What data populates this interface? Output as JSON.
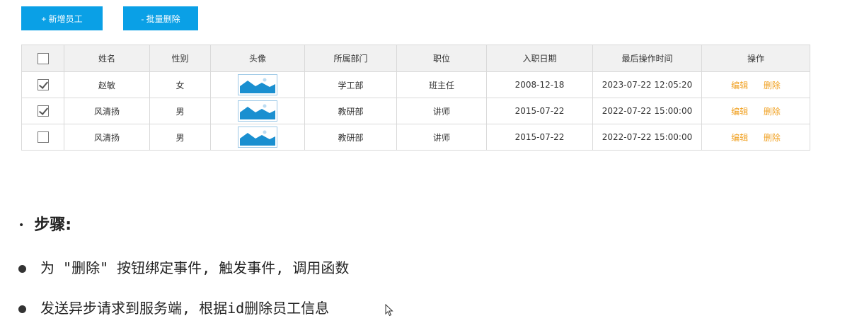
{
  "toolbar": {
    "add_label": "+ 新增员工",
    "batch_delete_label": "- 批量删除"
  },
  "table": {
    "headers": [
      "姓名",
      "性别",
      "头像",
      "所属部门",
      "职位",
      "入职日期",
      "最后操作时间",
      "操作"
    ],
    "rows": [
      {
        "checked": true,
        "name": "赵敏",
        "gender": "女",
        "dept": "学工部",
        "position": "班主任",
        "entry_date": "2008-12-18",
        "last_op": "2023-07-22 12:05:20",
        "edit": "编辑",
        "delete": "删除"
      },
      {
        "checked": true,
        "name": "风清扬",
        "gender": "男",
        "dept": "教研部",
        "position": "讲师",
        "entry_date": "2015-07-22",
        "last_op": "2022-07-22 15:00:00",
        "edit": "编辑",
        "delete": "删除"
      },
      {
        "checked": false,
        "name": "风清扬",
        "gender": "男",
        "dept": "教研部",
        "position": "讲师",
        "entry_date": "2015-07-22",
        "last_op": "2022-07-22 15:00:00",
        "edit": "编辑",
        "delete": "删除"
      }
    ]
  },
  "steps": {
    "title": "步骤:",
    "items": [
      "为 \"删除\" 按钮绑定事件, 触发事件, 调用函数",
      "发送异步请求到服务端, 根据id删除员工信息"
    ]
  },
  "colors": {
    "button_bg": "#0aa0e6",
    "link_orange": "#f0a020",
    "header_bg": "#f1f1f1"
  },
  "icons": {
    "avatar": "image-placeholder-icon",
    "cursor": "mouse-pointer-icon"
  }
}
